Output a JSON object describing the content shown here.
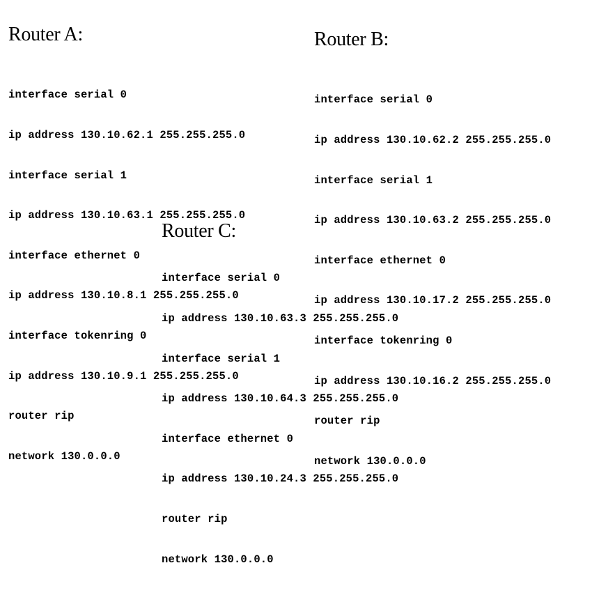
{
  "routers": [
    {
      "title": "Router A:",
      "lines": [
        "interface serial 0",
        "ip address 130.10.62.1 255.255.255.0",
        "interface serial 1",
        "ip address 130.10.63.1 255.255.255.0",
        "interface ethernet 0",
        "ip address 130.10.8.1 255.255.255.0",
        "interface tokenring 0",
        "ip address 130.10.9.1 255.255.255.0",
        "router rip",
        "network 130.0.0.0"
      ]
    },
    {
      "title": "Router B:",
      "lines": [
        "interface serial 0",
        "ip address 130.10.62.2 255.255.255.0",
        "interface serial 1",
        "ip address 130.10.63.2 255.255.255.0",
        "interface ethernet 0",
        "ip address 130.10.17.2 255.255.255.0",
        "interface tokenring 0",
        "ip address 130.10.16.2 255.255.255.0",
        "router rip",
        "network 130.0.0.0"
      ]
    },
    {
      "title": "Router C:",
      "lines": [
        "interface serial 0",
        "ip address 130.10.63.3 255.255.255.0",
        "interface serial 1",
        "ip address 130.10.64.3 255.255.255.0",
        "interface ethernet 0",
        "ip address 130.10.24.3 255.255.255.0",
        "router rip",
        "network 130.0.0.0"
      ]
    }
  ]
}
